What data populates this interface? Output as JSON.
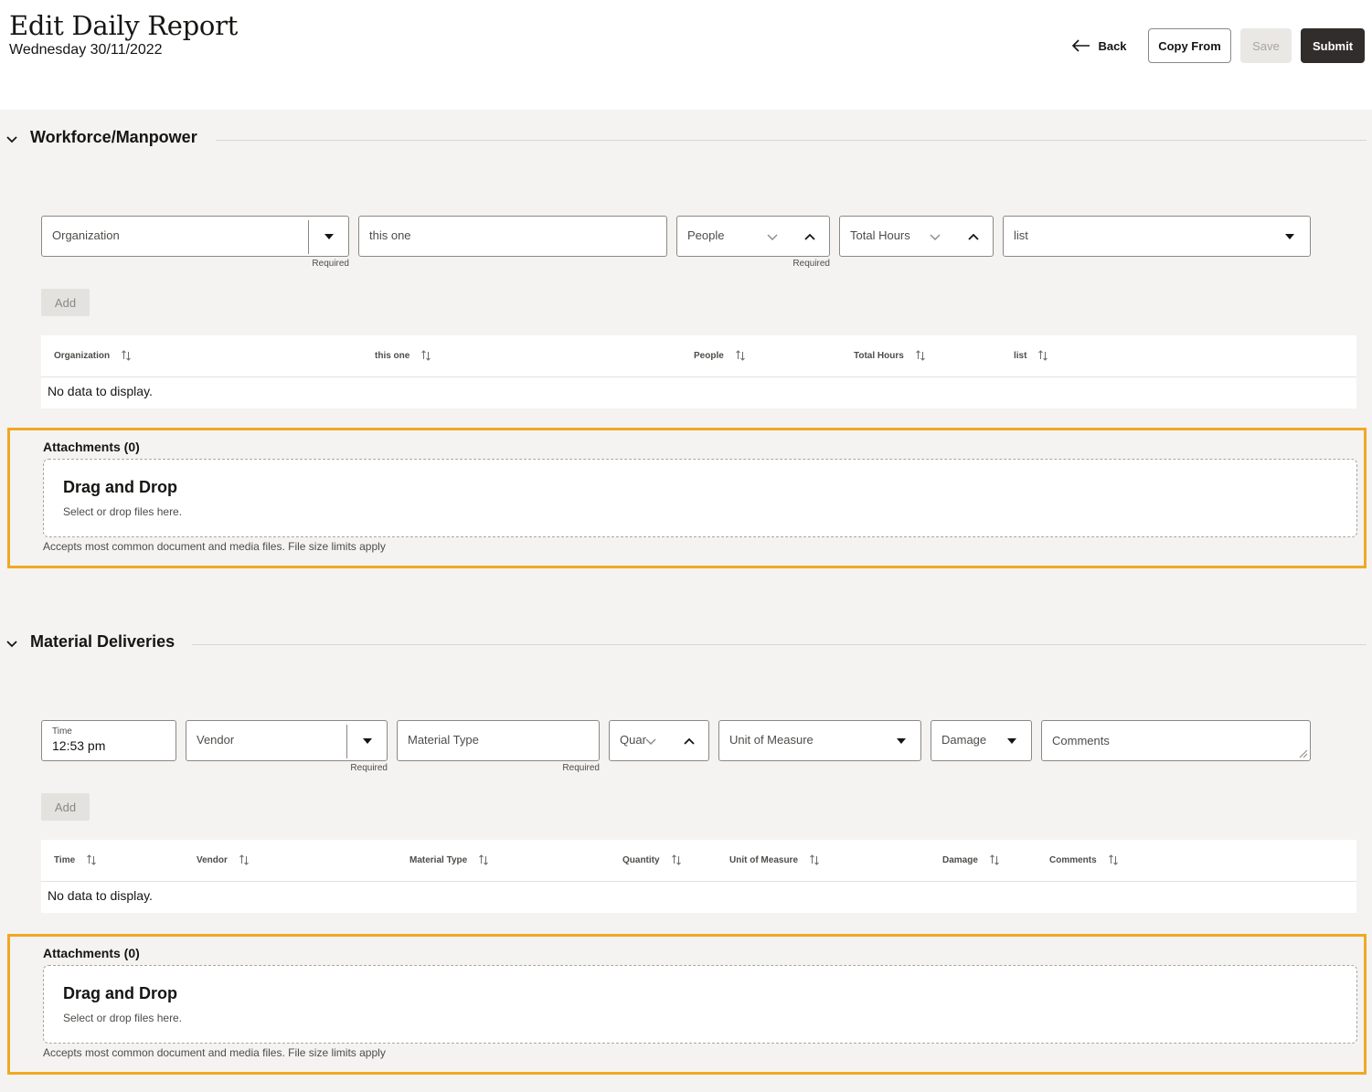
{
  "header": {
    "title": "Edit Daily Report",
    "date": "Wednesday 30/11/2022",
    "back_label": "Back",
    "copy_from_label": "Copy From",
    "save_label": "Save",
    "submit_label": "Submit"
  },
  "workforce": {
    "section_title": "Workforce/Manpower",
    "fields": {
      "organization": "Organization",
      "this_one": "this one",
      "people": "People",
      "total_hours": "Total Hours",
      "list": "list"
    },
    "required_label": "Required",
    "add_label": "Add",
    "columns": [
      "Organization",
      "this one",
      "People",
      "Total Hours",
      "list"
    ],
    "empty_text": "No data to display.",
    "attachments": {
      "title": "Attachments (0)",
      "drop_title": "Drag and Drop",
      "drop_sub": "Select or drop files here.",
      "note": "Accepts most common document and media files. File size limits apply"
    }
  },
  "materials": {
    "section_title": "Material Deliveries",
    "fields": {
      "time_label": "Time",
      "time_value": "12:53 pm",
      "vendor": "Vendor",
      "material_type": "Material Type",
      "quantity": "Quar",
      "unit_of_measure": "Unit of Measure",
      "damage": "Damage",
      "comments": "Comments"
    },
    "required_label": "Required",
    "add_label": "Add",
    "columns": [
      "Time",
      "Vendor",
      "Material Type",
      "Quantity",
      "Unit of Measure",
      "Damage",
      "Comments"
    ],
    "empty_text": "No data to display.",
    "attachments": {
      "title": "Attachments (0)",
      "drop_title": "Drag and Drop",
      "drop_sub": "Select or drop files here.",
      "note": "Accepts most common document and media files. File size limits apply"
    }
  },
  "colors": {
    "highlight": "#f0a822",
    "submit_bg": "#312d2a",
    "content_bg": "#f4f3f1"
  }
}
